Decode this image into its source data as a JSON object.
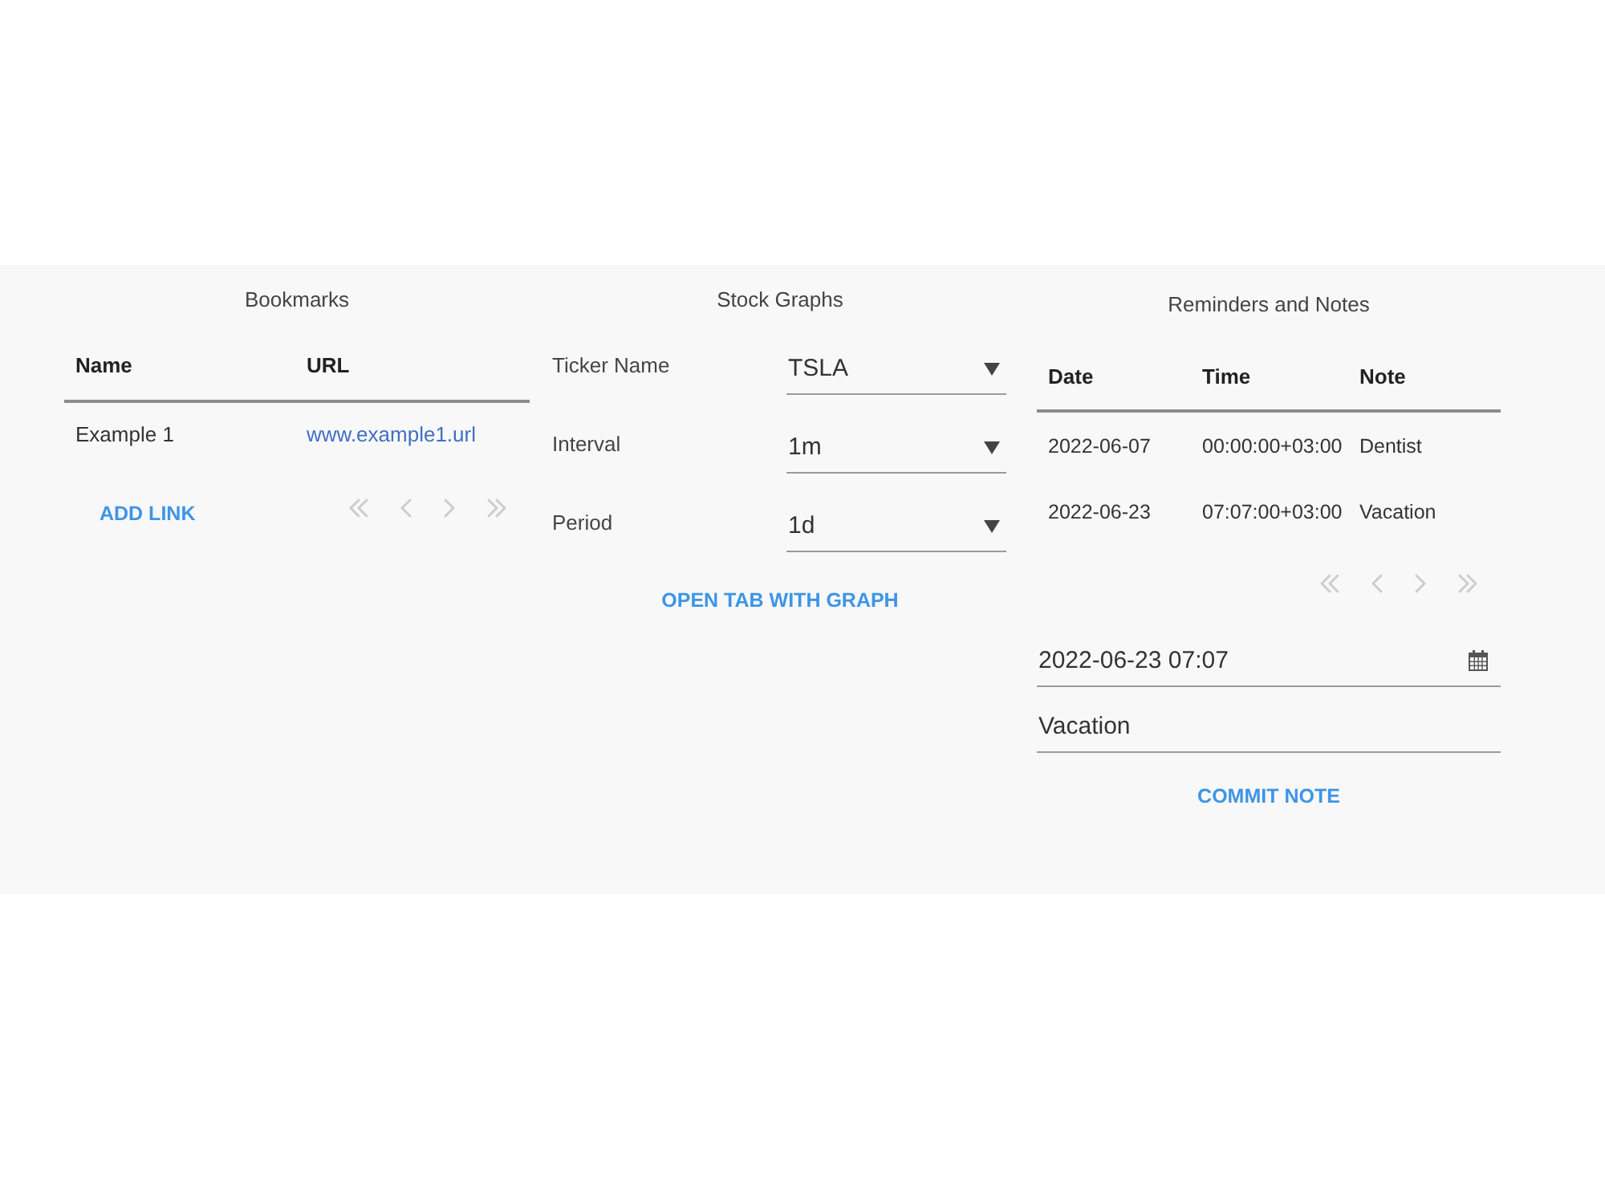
{
  "bookmarks": {
    "title": "Bookmarks",
    "columns": [
      "Name",
      "URL"
    ],
    "rows": [
      {
        "cells": [
          {
            "text": "Example 1",
            "kind": "text"
          },
          {
            "text": "www.example1.url",
            "kind": "link"
          }
        ]
      }
    ],
    "add_button": "ADD LINK",
    "pager": [
      {
        "kind": "first",
        "disabled": true
      },
      {
        "kind": "prev",
        "disabled": true
      },
      {
        "kind": "next",
        "disabled": true
      },
      {
        "kind": "last",
        "disabled": true
      }
    ]
  },
  "stock_graphs": {
    "title": "Stock Graphs",
    "fields": [
      {
        "label": "Ticker Name",
        "value": "TSLA"
      },
      {
        "label": "Interval",
        "value": "1m"
      },
      {
        "label": "Period",
        "value": "1d"
      }
    ],
    "button": "OPEN TAB WITH GRAPH"
  },
  "reminders": {
    "title": "Reminders and Notes",
    "columns": [
      "Date",
      "Time",
      "Note"
    ],
    "rows": [
      {
        "cells": [
          {
            "text": "2022-06-07",
            "kind": "text"
          },
          {
            "text": "00:00:00+03:00",
            "kind": "text"
          },
          {
            "text": "Dentist",
            "kind": "text"
          }
        ]
      },
      {
        "cells": [
          {
            "text": "2022-06-23",
            "kind": "text"
          },
          {
            "text": "07:07:00+03:00",
            "kind": "text"
          },
          {
            "text": "Vacation",
            "kind": "text"
          }
        ]
      }
    ],
    "pager": [
      {
        "kind": "first",
        "disabled": true
      },
      {
        "kind": "prev",
        "disabled": true
      },
      {
        "kind": "next",
        "disabled": true
      },
      {
        "kind": "last",
        "disabled": true
      }
    ],
    "datetime_field": {
      "value": "2022-06-23 07:07"
    },
    "note_field": {
      "value": "Vacation"
    },
    "button": "COMMIT NOTE"
  }
}
